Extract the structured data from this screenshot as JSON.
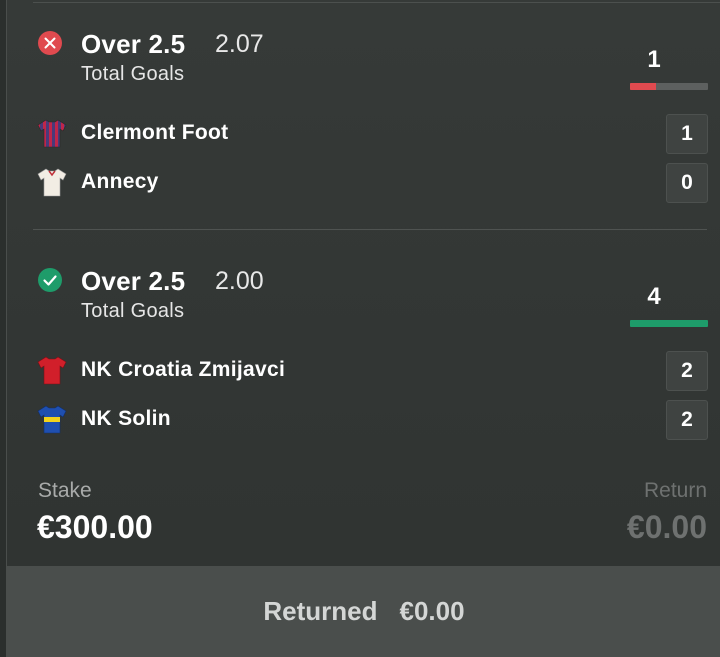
{
  "legs": [
    {
      "status": "lost",
      "status_icon": "x-circle-icon",
      "status_color": "#e04a4f",
      "market": "Over 2.5",
      "odds": "2.07",
      "market_type": "Total Goals",
      "total": "1",
      "progress_fraction": 0.33,
      "bar_color": "#e04a4f",
      "teams": [
        {
          "name": "Clermont Foot",
          "score": "1",
          "shirt_icon": "striped-red-blue-shirt-icon"
        },
        {
          "name": "Annecy",
          "score": "0",
          "shirt_icon": "white-red-shirt-icon"
        }
      ]
    },
    {
      "status": "won",
      "status_icon": "check-circle-icon",
      "status_color": "#1e9c6a",
      "market": "Over 2.5",
      "odds": "2.00",
      "market_type": "Total Goals",
      "total": "4",
      "progress_fraction": 1.0,
      "bar_color": "#1e9c6a",
      "teams": [
        {
          "name": "NK Croatia Zmijavci",
          "score": "2",
          "shirt_icon": "red-shirt-icon"
        },
        {
          "name": "NK Solin",
          "score": "2",
          "shirt_icon": "blue-yellow-shirt-icon"
        }
      ]
    }
  ],
  "stake": {
    "label": "Stake",
    "value": "€300.00"
  },
  "return": {
    "label": "Return",
    "value": "€0.00"
  },
  "returned": {
    "label": "Returned",
    "value": "€0.00"
  }
}
